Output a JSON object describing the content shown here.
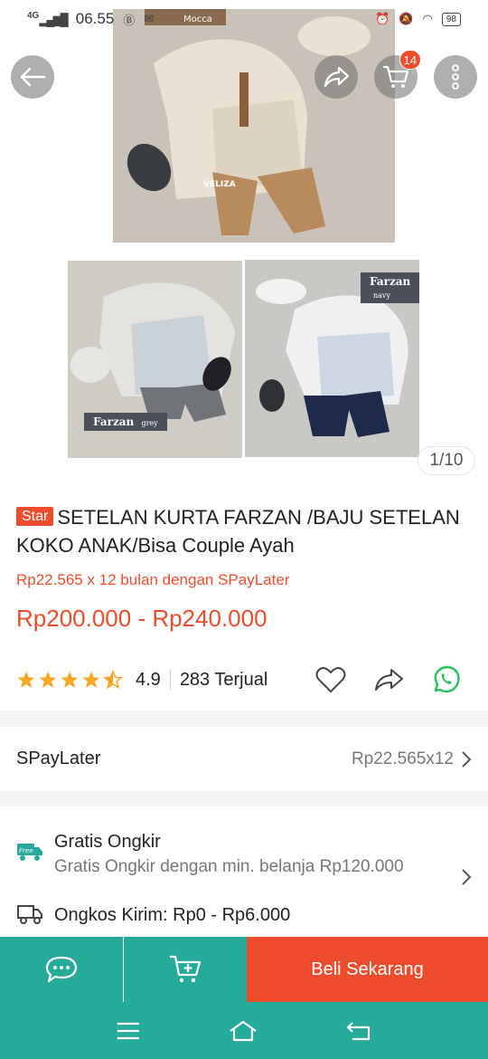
{
  "status_bar": {
    "network": "4G",
    "time": "06.55",
    "battery": "98"
  },
  "gallery": {
    "main_photo_label": "Mocca",
    "main_watermark": "VELIZA",
    "thumb_left_tag": "Farzan",
    "thumb_left_sub": "grey",
    "thumb_right_tag": "Farzan",
    "thumb_right_sub": "navy",
    "cart_badge": "14",
    "counter": "1/10"
  },
  "product": {
    "tag": "Star",
    "title": "SETELAN KURTA FARZAN  /BAJU SETELAN KOKO ANAK/Bisa Couple Ayah",
    "installment": "Rp22.565 x 12 bulan dengan SPayLater",
    "price": "Rp200.000 - Rp240.000",
    "rating": "4.9",
    "sold": "283 Terjual",
    "rating_stars": 4.5
  },
  "spaylater": {
    "label": "SPayLater",
    "value": "Rp22.565x12"
  },
  "shipping": {
    "free_icon_text": "Free",
    "title": "Gratis Ongkir",
    "subtitle": "Gratis Ongkir dengan min. belanja Rp120.000",
    "cost": "Ongkos Kirim: Rp0 - Rp6.000"
  },
  "action_bar": {
    "buy_label": "Beli Sekarang"
  },
  "colors": {
    "brand_orange": "#ee4d2d",
    "teal": "#26aa99",
    "star": "#f6a623",
    "whatsapp": "#25c35e"
  }
}
